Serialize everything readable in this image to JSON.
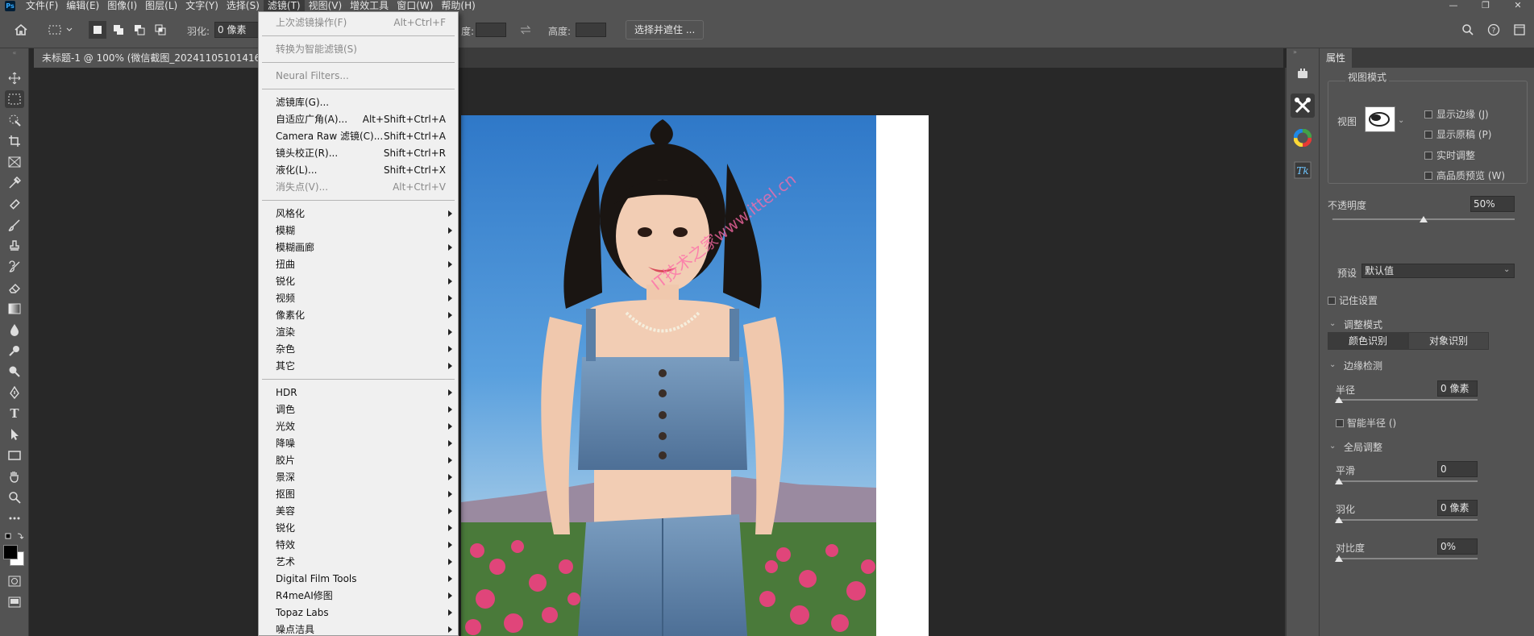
{
  "menubar": {
    "logo": "Ps",
    "items": [
      "文件(F)",
      "编辑(E)",
      "图像(I)",
      "图层(L)",
      "文字(Y)",
      "选择(S)",
      "滤镜(T)",
      "视图(V)",
      "增效工具",
      "窗口(W)",
      "帮助(H)"
    ],
    "active_index": 6,
    "window_controls": [
      "—",
      "❐",
      "✕"
    ]
  },
  "optbar": {
    "feather_label": "羽化:",
    "feather_value": "0 像素",
    "height_label": "高度:",
    "width_label_partial": "度:",
    "select_mask_button": "选择并遮住 ..."
  },
  "document": {
    "tab_title": "未标题-1 @ 100% (微信截图_20241105101416, RGB"
  },
  "watermark": "IT技术之家www.ittel.cn",
  "filter_menu": {
    "items": [
      {
        "label": "上次滤镜操作(F)",
        "shortcut": "Alt+Ctrl+F",
        "disabled": true
      },
      {
        "sep": true
      },
      {
        "label": "转换为智能滤镜(S)",
        "disabled": true
      },
      {
        "sep": true
      },
      {
        "label": "Neural Filters...",
        "disabled": true
      },
      {
        "sep": true
      },
      {
        "label": "滤镜库(G)..."
      },
      {
        "label": "自适应广角(A)...",
        "shortcut": "Alt+Shift+Ctrl+A"
      },
      {
        "label": "Camera Raw 滤镜(C)...",
        "shortcut": "Shift+Ctrl+A"
      },
      {
        "label": "镜头校正(R)...",
        "shortcut": "Shift+Ctrl+R"
      },
      {
        "label": "液化(L)...",
        "shortcut": "Shift+Ctrl+X"
      },
      {
        "label": "消失点(V)...",
        "shortcut": "Alt+Ctrl+V",
        "disabled": true
      },
      {
        "sep": true
      },
      {
        "label": "风格化",
        "submenu": true
      },
      {
        "label": "模糊",
        "submenu": true
      },
      {
        "label": "模糊画廊",
        "submenu": true
      },
      {
        "label": "扭曲",
        "submenu": true
      },
      {
        "label": "锐化",
        "submenu": true
      },
      {
        "label": "视频",
        "submenu": true
      },
      {
        "label": "像素化",
        "submenu": true
      },
      {
        "label": "渲染",
        "submenu": true
      },
      {
        "label": "杂色",
        "submenu": true
      },
      {
        "label": "其它",
        "submenu": true
      },
      {
        "sep": true
      },
      {
        "label": " HDR",
        "submenu": true
      },
      {
        "label": " 调色",
        "submenu": true
      },
      {
        "label": " 光效",
        "submenu": true
      },
      {
        "label": " 降噪",
        "submenu": true
      },
      {
        "label": " 胶片",
        "submenu": true
      },
      {
        "label": " 景深",
        "submenu": true
      },
      {
        "label": " 抠图",
        "submenu": true
      },
      {
        "label": " 美容",
        "submenu": true
      },
      {
        "label": " 锐化",
        "submenu": true
      },
      {
        "label": " 特效",
        "submenu": true
      },
      {
        "label": " 艺术",
        "submenu": true
      },
      {
        "label": "Digital Film Tools",
        "submenu": true
      },
      {
        "label": "R4meAI修图",
        "submenu": true
      },
      {
        "label": "Topaz Labs",
        "submenu": true
      },
      {
        "label": "噪点洁具",
        "submenu": true
      }
    ]
  },
  "properties": {
    "tab": "属性",
    "view_mode_title": "视图模式",
    "view_label": "视图",
    "checks": [
      "显示边缘 (J)",
      "显示原稿 (P)",
      "实时调整",
      "高品质预览 (W)"
    ],
    "opacity_label": "不透明度",
    "opacity_value": "50%",
    "opacity": 0.5,
    "preset_label": "预设",
    "preset_value": "默认值",
    "remember_label": "记住设置",
    "adjust_mode_title": "调整模式",
    "seg_color": "颜色识别",
    "seg_object": "对象识别",
    "edge_title": "边缘检测",
    "radius_label": "半径",
    "radius_value": "0 像素",
    "smart_radius_label": "智能半径 ()",
    "global_title": "全局调整",
    "smooth_label": "平滑",
    "smooth_value": "0",
    "feather_label": "羽化",
    "feather_value": "0 像素",
    "contrast_label": "对比度",
    "contrast_value": "0%"
  },
  "colors": {
    "panel": "#535353",
    "dark": "#282828",
    "menu_bg": "#f0f0f0",
    "accent": "#31a8ff"
  }
}
